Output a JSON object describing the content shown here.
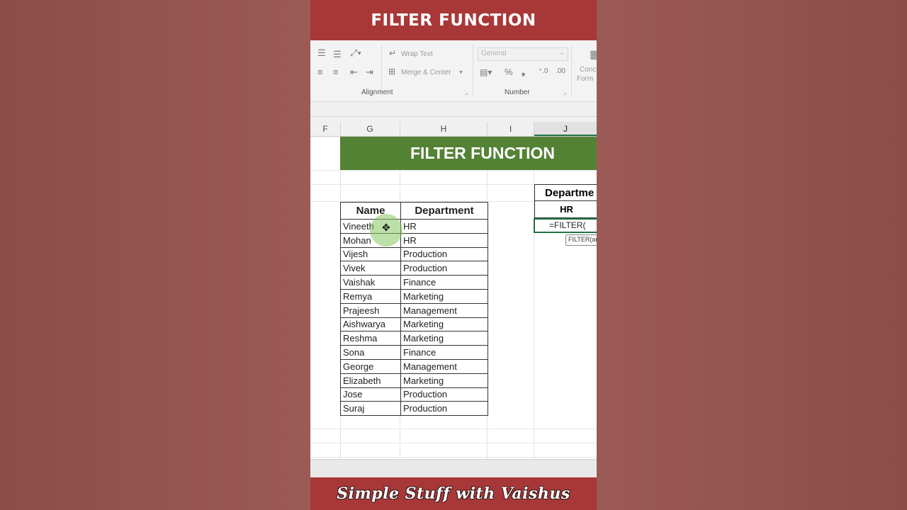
{
  "banner": {
    "top": "FILTER FUNCTION",
    "bottom": "Simple Stuff with Vaishus"
  },
  "ribbon": {
    "wrap_text": "Wrap Text",
    "merge_center": "Merge & Center",
    "number_format": "General",
    "alignment_label": "Alignment",
    "number_label": "Number",
    "conditional_label_1": "Conc",
    "conditional_label_2": "Form"
  },
  "columns": [
    "F",
    "G",
    "H",
    "I",
    "J"
  ],
  "sheet": {
    "title": "FILTER FUNCTION",
    "headers": {
      "name": "Name",
      "department": "Department"
    },
    "rows": [
      {
        "name": "Vineeth",
        "department": "HR"
      },
      {
        "name": "Mohan",
        "department": "HR"
      },
      {
        "name": "Vijesh",
        "department": "Production"
      },
      {
        "name": "Vivek",
        "department": "Production"
      },
      {
        "name": "Vaishak",
        "department": "Finance"
      },
      {
        "name": "Remya",
        "department": "Marketing"
      },
      {
        "name": "Prajeesh",
        "department": "Management"
      },
      {
        "name": "Aishwarya",
        "department": "Marketing"
      },
      {
        "name": "Reshma",
        "department": "Marketing"
      },
      {
        "name": "Sona",
        "department": "Finance"
      },
      {
        "name": "George",
        "department": "Management"
      },
      {
        "name": "Elizabeth",
        "department": "Marketing"
      },
      {
        "name": "Jose",
        "department": "Production"
      },
      {
        "name": "Suraj",
        "department": "Production"
      }
    ],
    "criteria_header": "Departme",
    "criteria_value": "HR",
    "formula": "=FILTER(",
    "tooltip": "FILTER(ar"
  },
  "colors": {
    "banner": "#a83838",
    "title_fill": "#548235",
    "selection": "#217346"
  }
}
